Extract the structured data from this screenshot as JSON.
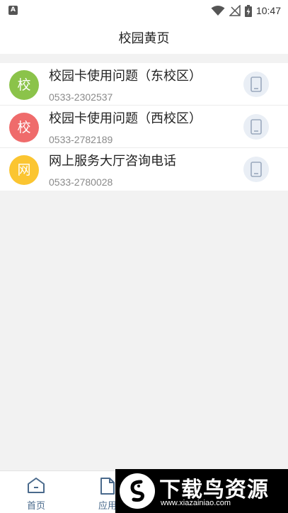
{
  "status_bar": {
    "notification_icon": "A",
    "time": "10:47",
    "icons": [
      "wifi-icon",
      "signal-off-icon",
      "battery-charging-icon"
    ]
  },
  "header": {
    "title": "校园黄页"
  },
  "contacts": [
    {
      "avatar_char": "校",
      "avatar_color": "#8bc34a",
      "name": "校园卡使用问题（东校区）",
      "phone": "0533-2302537",
      "action_icon": "phone-icon"
    },
    {
      "avatar_char": "校",
      "avatar_color": "#ef6b6b",
      "name": "校园卡使用问题（西校区）",
      "phone": "0533-2782189",
      "action_icon": "phone-icon"
    },
    {
      "avatar_char": "网",
      "avatar_color": "#fbc531",
      "name": "网上服务大厅咨询电话",
      "phone": "0533-2780028",
      "action_icon": "phone-icon"
    }
  ],
  "bottom_nav": {
    "items": [
      {
        "label": "首页",
        "icon": "home-icon"
      },
      {
        "label": "应用",
        "icon": "apps-icon"
      }
    ]
  },
  "watermark": {
    "text": "下载鸟资源",
    "url": "www.xiazainiao.com"
  }
}
